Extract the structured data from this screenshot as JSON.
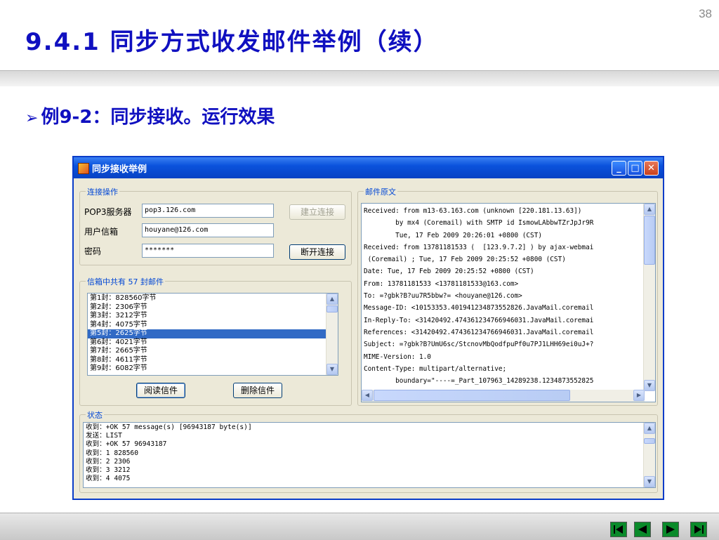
{
  "slide": {
    "number": "38",
    "title": "9.4.1  同步方式收发邮件举例（续）",
    "bullet": "例9-2：同步接收。运行效果"
  },
  "window": {
    "title": "同步接收举例",
    "controls": {
      "minimize": "_",
      "maximize": "□",
      "close": "✕"
    }
  },
  "connection": {
    "group_label": "连接操作",
    "pop3_label": "POP3服务器",
    "pop3_value": "pop3.126.com",
    "user_label": "用户信箱",
    "user_value": "houyane@126.com",
    "password_label": "密码",
    "password_value": "*******",
    "connect_button": "建立连接",
    "disconnect_button": "断开连接"
  },
  "mailbox": {
    "group_label": "信箱中共有 57 封邮件",
    "items": [
      "第1封：828560字节",
      "第2封：2306字节",
      "第3封：3212字节",
      "第4封：4075字节",
      "第5封：2625字节",
      "第6封：4021字节",
      "第7封：2665字节",
      "第8封：4611字节",
      "第9封：6082字节"
    ],
    "selected_index": 4,
    "read_button": "阅读信件",
    "delete_button": "删除信件"
  },
  "message": {
    "group_label": "邮件原文",
    "lines": [
      "Received: from m13-63.163.com (unknown [220.181.13.63])",
      "        by mx4 (Coremail) with SMTP id IsmowLAbbwTZrJpJr9R",
      "        Tue, 17 Feb 2009 20:26:01 +0800 (CST)",
      "Received: from 13781181533 (  [123.9.7.2] ) by ajax-webmai",
      " (Coremail) ; Tue, 17 Feb 2009 20:25:52 +0800 (CST)",
      "Date: Tue, 17 Feb 2009 20:25:52 +0800 (CST)",
      "From: 13781181533 <13781181533@163.com>",
      "To: =?gbk?B?uu7R5bbw?= <houyane@126.com>",
      "Message-ID: <10153353.401941234873552826.JavaMail.coremail",
      "In-Reply-To: <31420492.474361234766946031.JavaMail.coremai",
      "References: <31420492.474361234766946031.JavaMail.coremail",
      "Subject: =?gbk?B?UmU6sc/StcnovMbQodfpuPf0u7PJ1LHH69ei0uJ+?",
      "MIME-Version: 1.0",
      "Content-Type: multipart/alternative;",
      "        boundary=\"----=_Part_107963_14289238.1234873552825"
    ]
  },
  "status": {
    "group_label": "状态",
    "lines": [
      "收到：+OK 57 message(s) [96943187 byte(s)]",
      "发送：LIST",
      "收到：+OK 57 96943187",
      "收到：1 828560",
      "收到：2 2306",
      "收到：3 3212",
      "收到：4 4075"
    ]
  },
  "nav": [
    "first-slide",
    "previous-slide",
    "next-slide",
    "last-slide"
  ],
  "colors": {
    "title": "#1010c0",
    "titlebar": "#0a52dc",
    "selection": "#316ac5",
    "nav": "#0a8a2a"
  }
}
